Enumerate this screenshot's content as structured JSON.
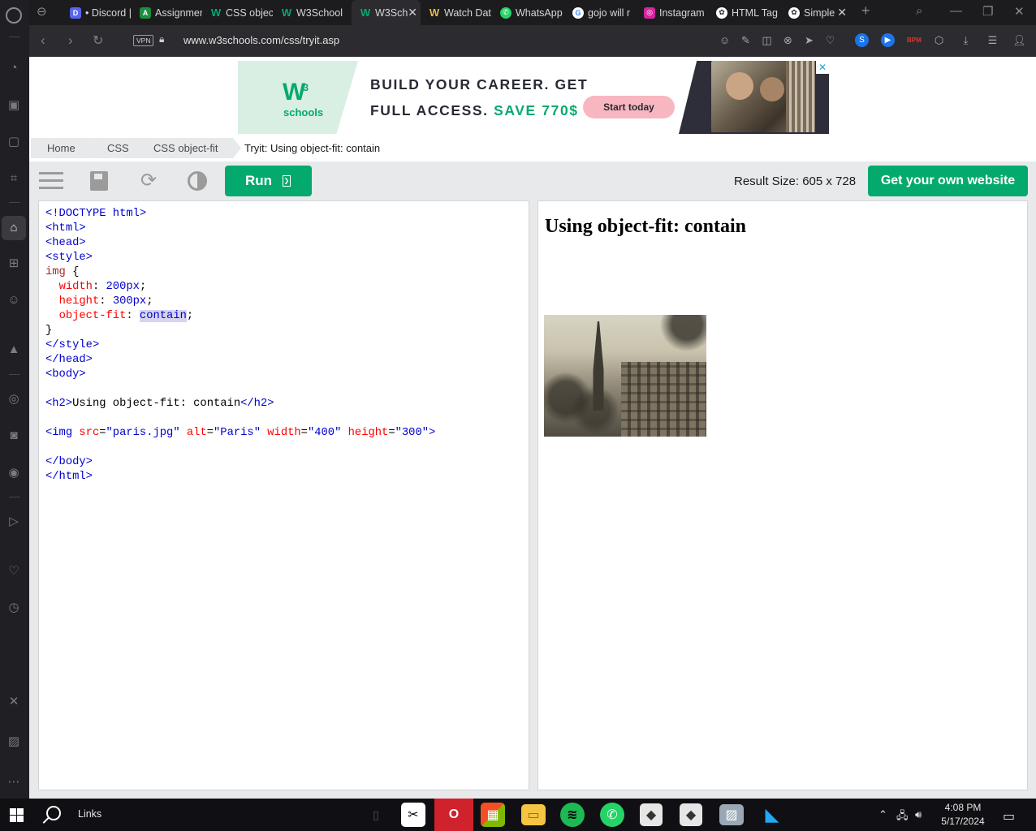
{
  "browser": {
    "tabs": [
      {
        "title": "• Discord |",
        "fav_color": "#5865f2",
        "fav_text": "D"
      },
      {
        "title": "Assignmen",
        "fav_color": "#1e8e3e",
        "fav_text": "A"
      },
      {
        "title": "CSS object",
        "fav_color": "#04aa6d",
        "fav_text": "W"
      },
      {
        "title": "W3School",
        "fav_color": "#04aa6d",
        "fav_text": "W"
      },
      {
        "title": "W3Sch",
        "fav_color": "#04aa6d",
        "fav_text": "W"
      },
      {
        "title": "Watch Dat",
        "fav_color": "#e8b84a",
        "fav_text": "W"
      },
      {
        "title": "WhatsApp",
        "fav_color": "#25d366",
        "fav_text": "✆"
      },
      {
        "title": "gojo will r",
        "fav_color": "#ffffff",
        "fav_text": "G"
      },
      {
        "title": "Instagram",
        "fav_color": "#d6249f",
        "fav_text": "◎"
      },
      {
        "title": "HTML Tag",
        "fav_color": "#ffffff",
        "fav_text": "✿"
      },
      {
        "title": "Simple",
        "fav_color": "#ffffff",
        "fav_text": "✿"
      }
    ],
    "url": "www.w3schools.com/css/tryit.asp",
    "vpn_label": "VPN",
    "accent": "#04aa6d"
  },
  "ad": {
    "line1": "BUILD YOUR CAREER. GET",
    "line2_a": "FULL ACCESS.",
    "line2_b": "SAVE 770$",
    "cta": "Start today",
    "logo_text": "schools",
    "logo_mark": "W",
    "logo_sup": "3"
  },
  "breadcrumb": {
    "items": [
      "Home",
      "CSS",
      "CSS object-fit"
    ],
    "current": "Tryit: Using object-fit: contain"
  },
  "toolbar": {
    "run_label": "Run",
    "run_glyph": "❯",
    "result_size": "Result Size: 605 x 728",
    "own_website": "Get your own website"
  },
  "editor": {
    "l1": "<!DOCTYPE html>",
    "l2": "<html>",
    "l3": "<head>",
    "l4": "<style>",
    "l5_sel": "img",
    "l5_brace": " {",
    "l6_prop": "width",
    "l6_val": "200px",
    "l7_prop": "height",
    "l7_val": "300px",
    "l8_prop": "object-fit",
    "l8_val": "contain",
    "l9": "}",
    "l10": "</style>",
    "l11": "</head>",
    "l12": "<body>",
    "l14_open": "<h2>",
    "l14_text": "Using object-fit: contain",
    "l14_close": "</h2>",
    "l16_tag": "<img",
    "l16_src_attr": "src",
    "l16_src_val": "\"paris.jpg\"",
    "l16_alt_attr": "alt",
    "l16_alt_val": "\"Paris\"",
    "l16_w_attr": "width",
    "l16_w_val": "\"400\"",
    "l16_h_attr": "height",
    "l16_h_val": "\"300\"",
    "l16_end": ">",
    "l18": "</body>",
    "l19": "</html>"
  },
  "result": {
    "heading": "Using object-fit: contain"
  },
  "taskbar": {
    "links_label": "Links",
    "time": "4:08 PM",
    "date": "5/17/2024"
  }
}
